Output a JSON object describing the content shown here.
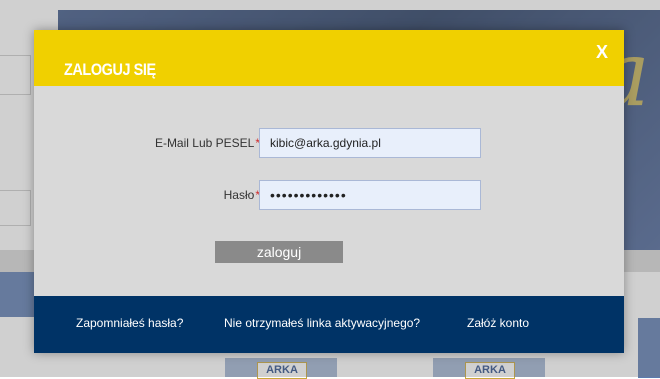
{
  "modal": {
    "title": "ZALOGUJ SIĘ",
    "close_label": "X",
    "fields": [
      {
        "label": "E-Mail Lub PESEL",
        "required_mark": "*",
        "value": "kibic@arka.gdynia.pl",
        "type": "text"
      },
      {
        "label": "Hasło",
        "required_mark": "*",
        "value": "•••••••••••••",
        "type": "password"
      }
    ],
    "submit_label": "zaloguj",
    "footer_links": [
      "Zapomniałeś hasła?",
      "Nie otrzymałeś linka aktywacyjnego?",
      "Załóż konto"
    ]
  },
  "background": {
    "thumbnail_label": "ARKA"
  },
  "colors": {
    "header_yellow": "#f0d000",
    "footer_navy": "#003366",
    "body_gray": "#d9d9d9",
    "button_gray": "#8a8a8a",
    "required_red": "#d12a2a"
  }
}
